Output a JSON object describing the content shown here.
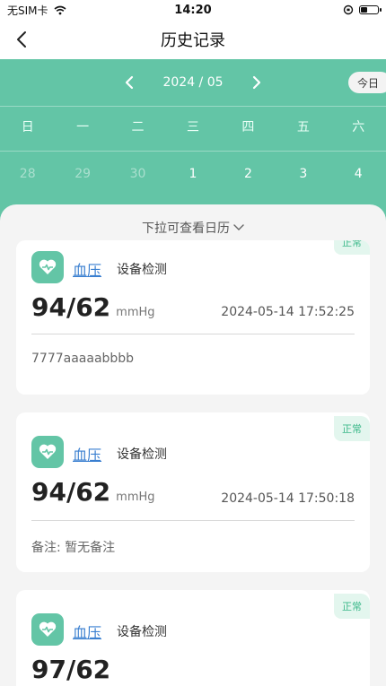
{
  "status_bar": {
    "carrier": "无SIM卡",
    "time": "14:20",
    "battery_level": 0.45
  },
  "nav": {
    "title": "历史记录"
  },
  "calendar": {
    "month": "2024 / 05",
    "today_label": "今日",
    "weekdays": [
      "日",
      "一",
      "二",
      "三",
      "四",
      "五",
      "六"
    ],
    "dates": [
      "28",
      "29",
      "30",
      "1",
      "2",
      "3",
      "4"
    ]
  },
  "sheet": {
    "pull_hint": "下拉可查看日历"
  },
  "records": [
    {
      "status": "正常",
      "type": "血压",
      "method": "设备检测",
      "value": "94/62",
      "unit": "mmHg",
      "time": "2024-05-14 17:52:25",
      "note": "7777aaaaabbbb"
    },
    {
      "status": "正常",
      "type": "血压",
      "method": "设备检测",
      "value": "94/62",
      "unit": "mmHg",
      "time": "2024-05-14 17:50:18",
      "note": "备注: 暂无备注"
    },
    {
      "status": "正常",
      "type": "血压",
      "method": "设备检测",
      "value": "97/62",
      "unit": "",
      "time": "",
      "note": ""
    }
  ],
  "colors": {
    "accent": "#63c5a6",
    "badge_text": "#3bb889",
    "link": "#3a7fd0"
  },
  "icons": {
    "back": "chevron-left-icon",
    "prev": "chevron-left-icon",
    "next": "chevron-right-icon",
    "record": "heart-pulse-icon"
  }
}
